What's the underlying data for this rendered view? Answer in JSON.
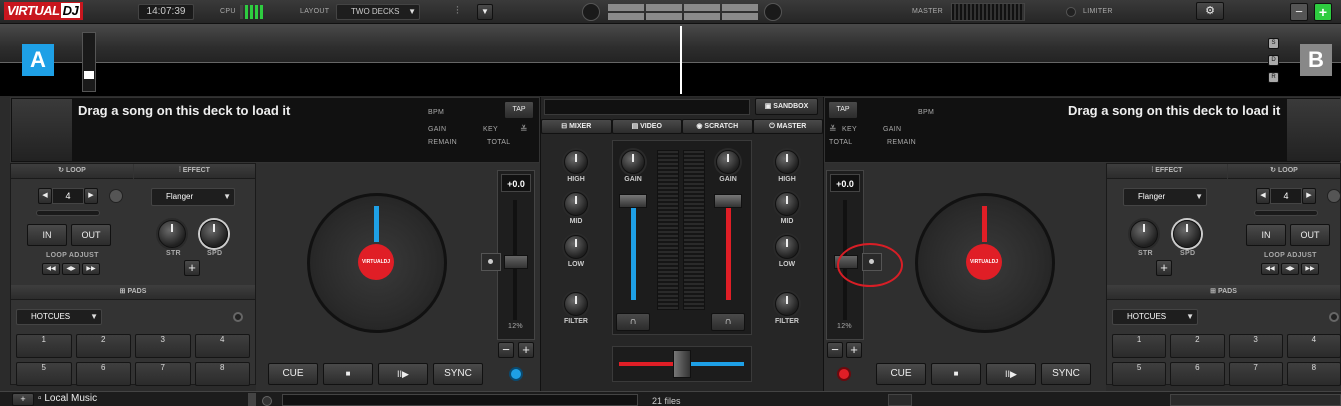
{
  "topbar": {
    "logo_a": "VIRTUAL",
    "logo_b": "DJ",
    "clock": "14:07:39",
    "cpu_label": "CPU",
    "layout_label": "LAYOUT",
    "layout_value": "TWO DECKS",
    "master_label": "MASTER",
    "limiter_label": "LIMITER",
    "minus": "−",
    "plus": "+"
  },
  "decks": {
    "a": {
      "letter": "A",
      "accent": "#1ea0e6",
      "load_hint": "Drag a song on this deck to load it",
      "bpm": "BPM",
      "tap": "TAP",
      "gain": "GAIN",
      "key": "KEY",
      "remain": "REMAIN",
      "total": "TOTAL",
      "pitch": "+0.0",
      "pitch_range": "12%",
      "loop_title": "LOOP",
      "loop_value": "4",
      "in": "IN",
      "out": "OUT",
      "loop_adjust": "LOOP ADJUST",
      "effect_title": "EFFECT",
      "effect_value": "Flanger",
      "str": "STR",
      "spd": "SPD",
      "pads_title": "PADS",
      "pads_mode": "HOTCUES",
      "pads": [
        "1",
        "2",
        "3",
        "4",
        "5",
        "6",
        "7",
        "8"
      ],
      "cue": "CUE",
      "play": "■",
      "pause": "II▶",
      "sync": "SYNC",
      "platter_label": "VIRTUALDJ"
    },
    "b": {
      "letter": "B",
      "accent": "#e01e26",
      "load_hint": "Drag a song on this deck to load it",
      "bpm": "BPM",
      "tap": "TAP",
      "gain": "GAIN",
      "key": "KEY",
      "remain": "REMAIN",
      "total": "TOTAL",
      "pitch": "+0.0",
      "pitch_range": "12%",
      "loop_title": "LOOP",
      "loop_value": "4",
      "in": "IN",
      "out": "OUT",
      "loop_adjust": "LOOP ADJUST",
      "effect_title": "EFFECT",
      "effect_value": "Flanger",
      "str": "STR",
      "spd": "SPD",
      "pads_title": "PADS",
      "pads_mode": "HOTCUES",
      "pads": [
        "1",
        "2",
        "3",
        "4",
        "5",
        "6",
        "7",
        "8"
      ],
      "cue": "CUE",
      "play": "■",
      "pause": "II▶",
      "sync": "SYNC",
      "platter_label": "VIRTUALDJ"
    }
  },
  "mixer": {
    "sandbox": "SANDBOX",
    "tabs": [
      "MIXER",
      "VIDEO",
      "SCRATCH",
      "MASTER"
    ],
    "gain": "GAIN",
    "high": "HIGH",
    "mid": "MID",
    "low": "LOW",
    "filter": "FILTER"
  },
  "browser": {
    "folder": "Local Music",
    "count": "21 files"
  },
  "side": {
    "s": "S",
    "d": "D",
    "r": "R"
  }
}
